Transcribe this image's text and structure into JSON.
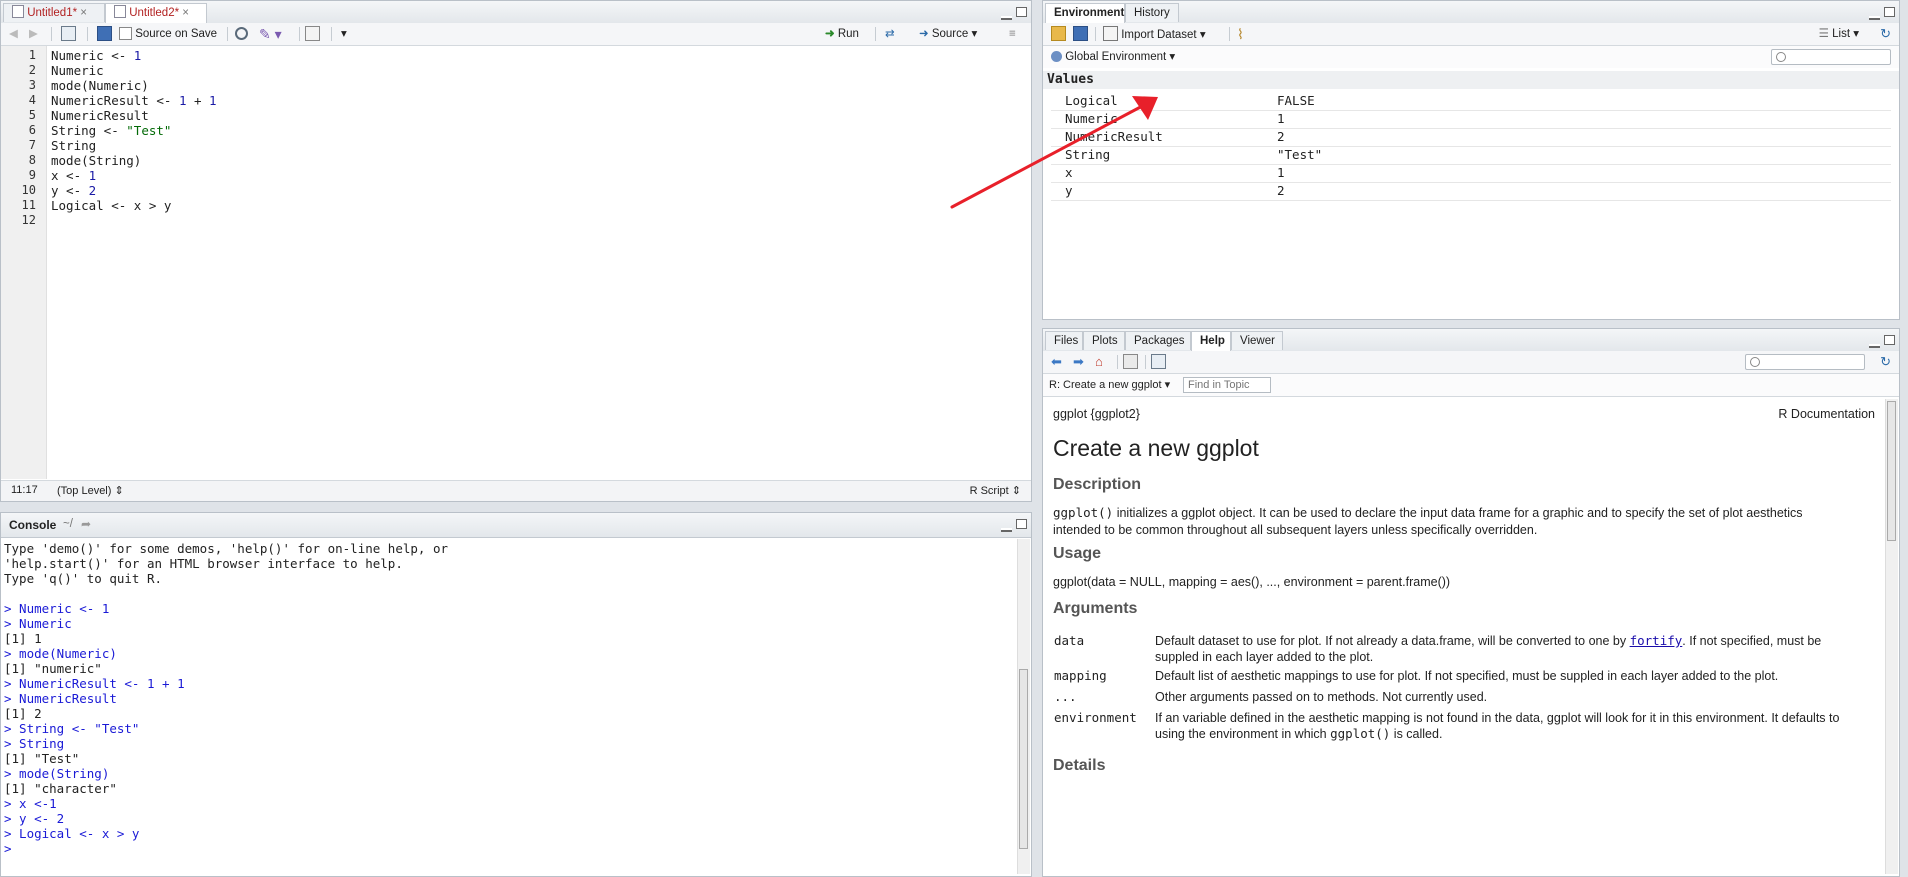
{
  "editor": {
    "tabs": [
      "Untitled1*",
      "Untitled2*"
    ],
    "source_on_save": "Source on Save",
    "run": "Run",
    "source": "Source",
    "line_numbers": [
      "1",
      "2",
      "3",
      "4",
      "5",
      "6",
      "7",
      "8",
      "9",
      "10",
      "11",
      "12"
    ],
    "cursor_pos": "11:17",
    "scope": "(Top Level)",
    "file_type": "R Script"
  },
  "console": {
    "title": "Console",
    "path": "~/",
    "lines": [
      {
        "t": "Type 'demo()' for some demos, 'help()' for on-line help, or",
        "c": "out"
      },
      {
        "t": "'help.start()' for an HTML browser interface to help.",
        "c": "out"
      },
      {
        "t": "Type 'q()' to quit R.",
        "c": "out"
      },
      {
        "t": "",
        "c": "out"
      },
      {
        "t": "> Numeric <- 1",
        "c": "cmd"
      },
      {
        "t": "> Numeric",
        "c": "cmd"
      },
      {
        "t": "[1] 1",
        "c": "out"
      },
      {
        "t": "> mode(Numeric)",
        "c": "cmd"
      },
      {
        "t": "[1] \"numeric\"",
        "c": "out"
      },
      {
        "t": "> NumericResult <- 1 + 1",
        "c": "cmd"
      },
      {
        "t": "> NumericResult",
        "c": "cmd"
      },
      {
        "t": "[1] 2",
        "c": "out"
      },
      {
        "t": "> String <- \"Test\"",
        "c": "cmd"
      },
      {
        "t": "> String",
        "c": "cmd"
      },
      {
        "t": "[1] \"Test\"",
        "c": "out"
      },
      {
        "t": "> mode(String)",
        "c": "cmd"
      },
      {
        "t": "[1] \"character\"",
        "c": "out"
      },
      {
        "t": "> x <-1",
        "c": "cmd"
      },
      {
        "t": "> y <- 2",
        "c": "cmd"
      },
      {
        "t": "> Logical <- x > y",
        "c": "cmd"
      },
      {
        "t": "> ",
        "c": "cmd"
      }
    ]
  },
  "environment": {
    "tabs": [
      "Environment",
      "History"
    ],
    "import_dataset": "Import Dataset",
    "view_mode": "List",
    "scope": "Global Environment",
    "section": "Values",
    "rows": [
      {
        "name": "Logical",
        "value": "FALSE"
      },
      {
        "name": "Numeric",
        "value": "1"
      },
      {
        "name": "NumericResult",
        "value": "2"
      },
      {
        "name": "String",
        "value": "\"Test\""
      },
      {
        "name": "x",
        "value": "1"
      },
      {
        "name": "y",
        "value": "2"
      }
    ]
  },
  "help": {
    "tabs": [
      "Files",
      "Plots",
      "Packages",
      "Help",
      "Viewer"
    ],
    "topic": "R: Create a new ggplot",
    "find_placeholder": "Find in Topic",
    "header_left": "ggplot {ggplot2}",
    "header_right": "R Documentation",
    "title": "Create a new ggplot",
    "description_heading": "Description",
    "description_code": "ggplot()",
    "description_text": " initializes a ggplot object. It can be used to declare the input data frame for a graphic and to specify the set of plot aesthetics",
    "description_text2": "intended to be common throughout all subsequent layers unless specifically overridden.",
    "usage_heading": "Usage",
    "usage_code": "ggplot(data = NULL, mapping = aes(), ..., environment = parent.frame())",
    "arguments_heading": "Arguments",
    "args": [
      {
        "name": "data",
        "desc1": "Default dataset to use for plot. If not already a data.frame, will be converted to one by ",
        "link": "fortify",
        "desc1b": ". If not specified, must be",
        "desc2": "suppled in each layer added to the plot."
      },
      {
        "name": "mapping",
        "desc1": "Default list of aesthetic mappings to use for plot. If not specified, must be suppled in each layer added to the plot."
      },
      {
        "name": "...",
        "desc1": "Other arguments passed on to methods. Not currently used."
      },
      {
        "name": "environment",
        "desc1": "If an variable defined in the aesthetic mapping is not found in the data, ggplot will look for it in this environment. It defaults to",
        "desc2a": "using the environment in which ",
        "desc2code": "ggplot()",
        "desc2b": " is called."
      }
    ],
    "details_heading": "Details"
  },
  "colors": {
    "annotation_arrow": "#e8202a",
    "command_blue": "#1a1ad6"
  }
}
